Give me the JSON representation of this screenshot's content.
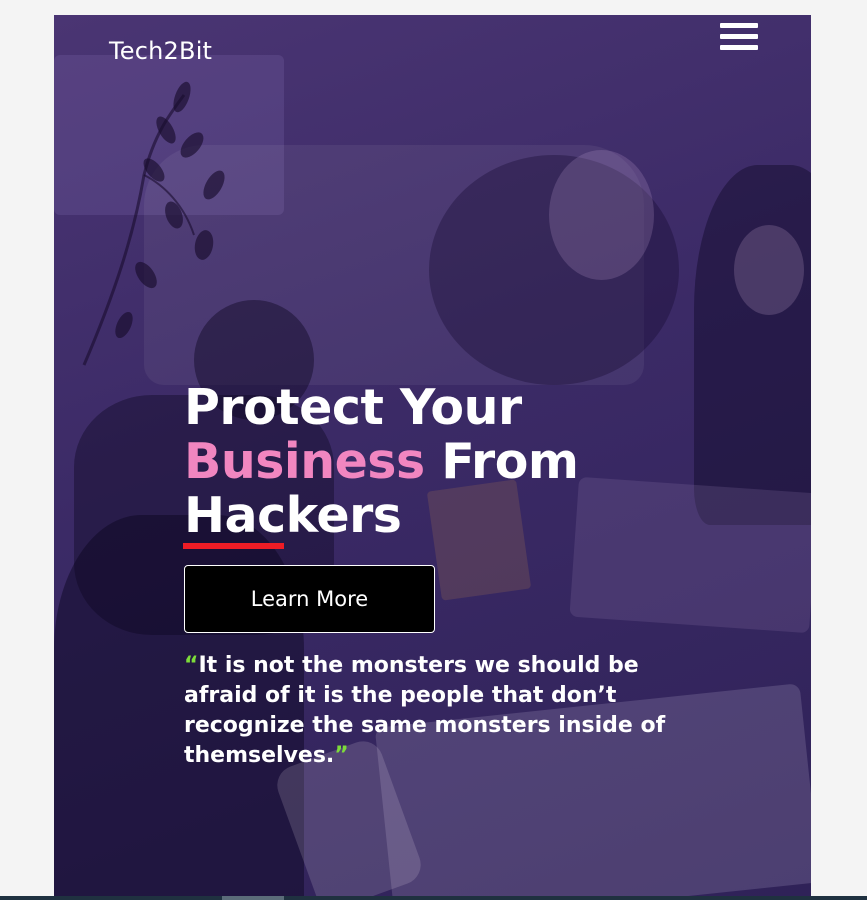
{
  "header": {
    "logo": "Tech2Bit",
    "menu_icon": "hamburger-menu-icon"
  },
  "hero": {
    "headline_line1": "Protect Your",
    "headline_highlight": "Business",
    "headline_line2_rest": " From",
    "headline_line3": "Hackers",
    "cta_label": "Learn More",
    "quote_open": "“",
    "quote_text": "It is not the monsters we should be afraid of it is the people that don’t recognize the same monsters inside of themselves.",
    "quote_close": "”"
  },
  "colors": {
    "overlay": "#3b2a66",
    "highlight_pink": "#f186c0",
    "underline_red": "#ee1c25",
    "quote_mark_green": "#7ddc3a",
    "button_bg": "#000000"
  }
}
